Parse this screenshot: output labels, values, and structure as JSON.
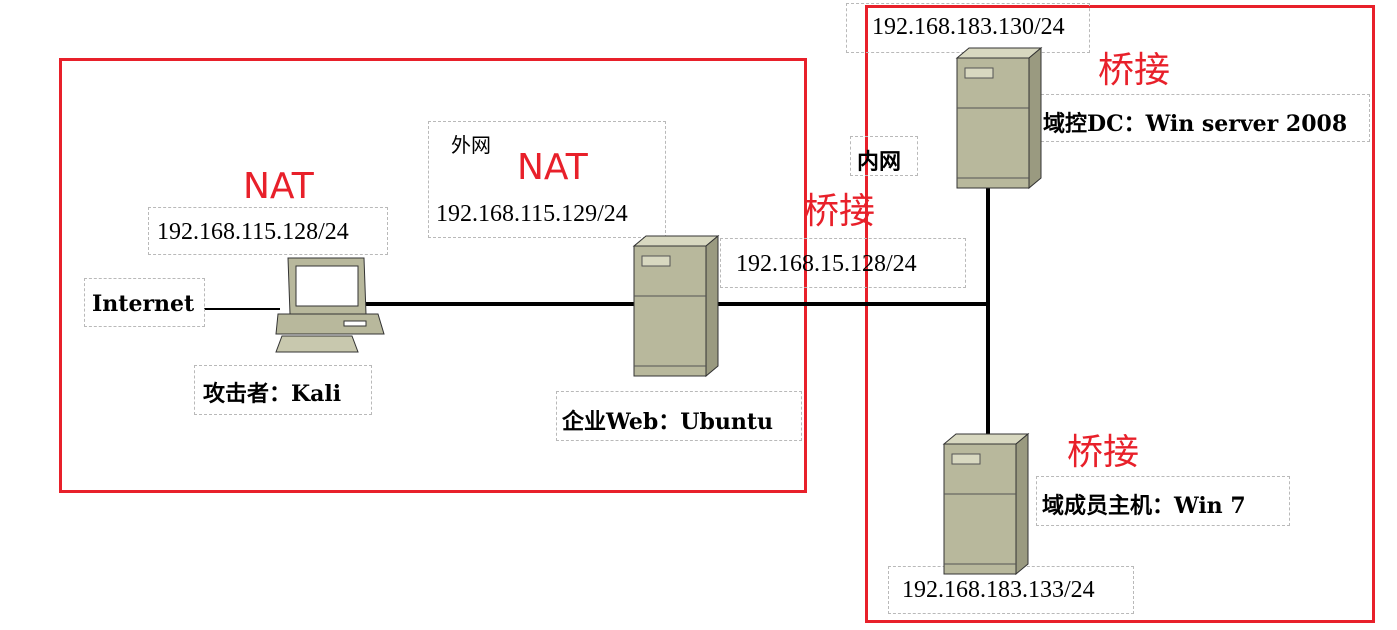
{
  "regions": {
    "left": {
      "label_a": "NAT",
      "label_b": "NAT"
    },
    "right": {
      "label_a": "桥接",
      "label_b": "桥接",
      "label_c": "桥接"
    }
  },
  "labels": {
    "outer_net": "外网",
    "inner_net": "内网",
    "internet": "Internet",
    "attacker": "攻击者：Kali",
    "web_server": "企业Web：Ubuntu",
    "dc": "域控DC：Win server 2008",
    "member": "域成员主机：Win 7"
  },
  "ips": {
    "kali": "192.168.115.128/24",
    "web_outer": "192.168.115.129/24",
    "web_inner": "192.168.15.128/24",
    "dc": "192.168.183.130/24",
    "member": "192.168.183.133/24"
  },
  "colors": {
    "region_border": "#e8202a",
    "server_body": "#b8b89c",
    "dashed_box": "#b9b9b9"
  },
  "icons": [
    "desktop-computer-icon",
    "server-tower-icon"
  ]
}
